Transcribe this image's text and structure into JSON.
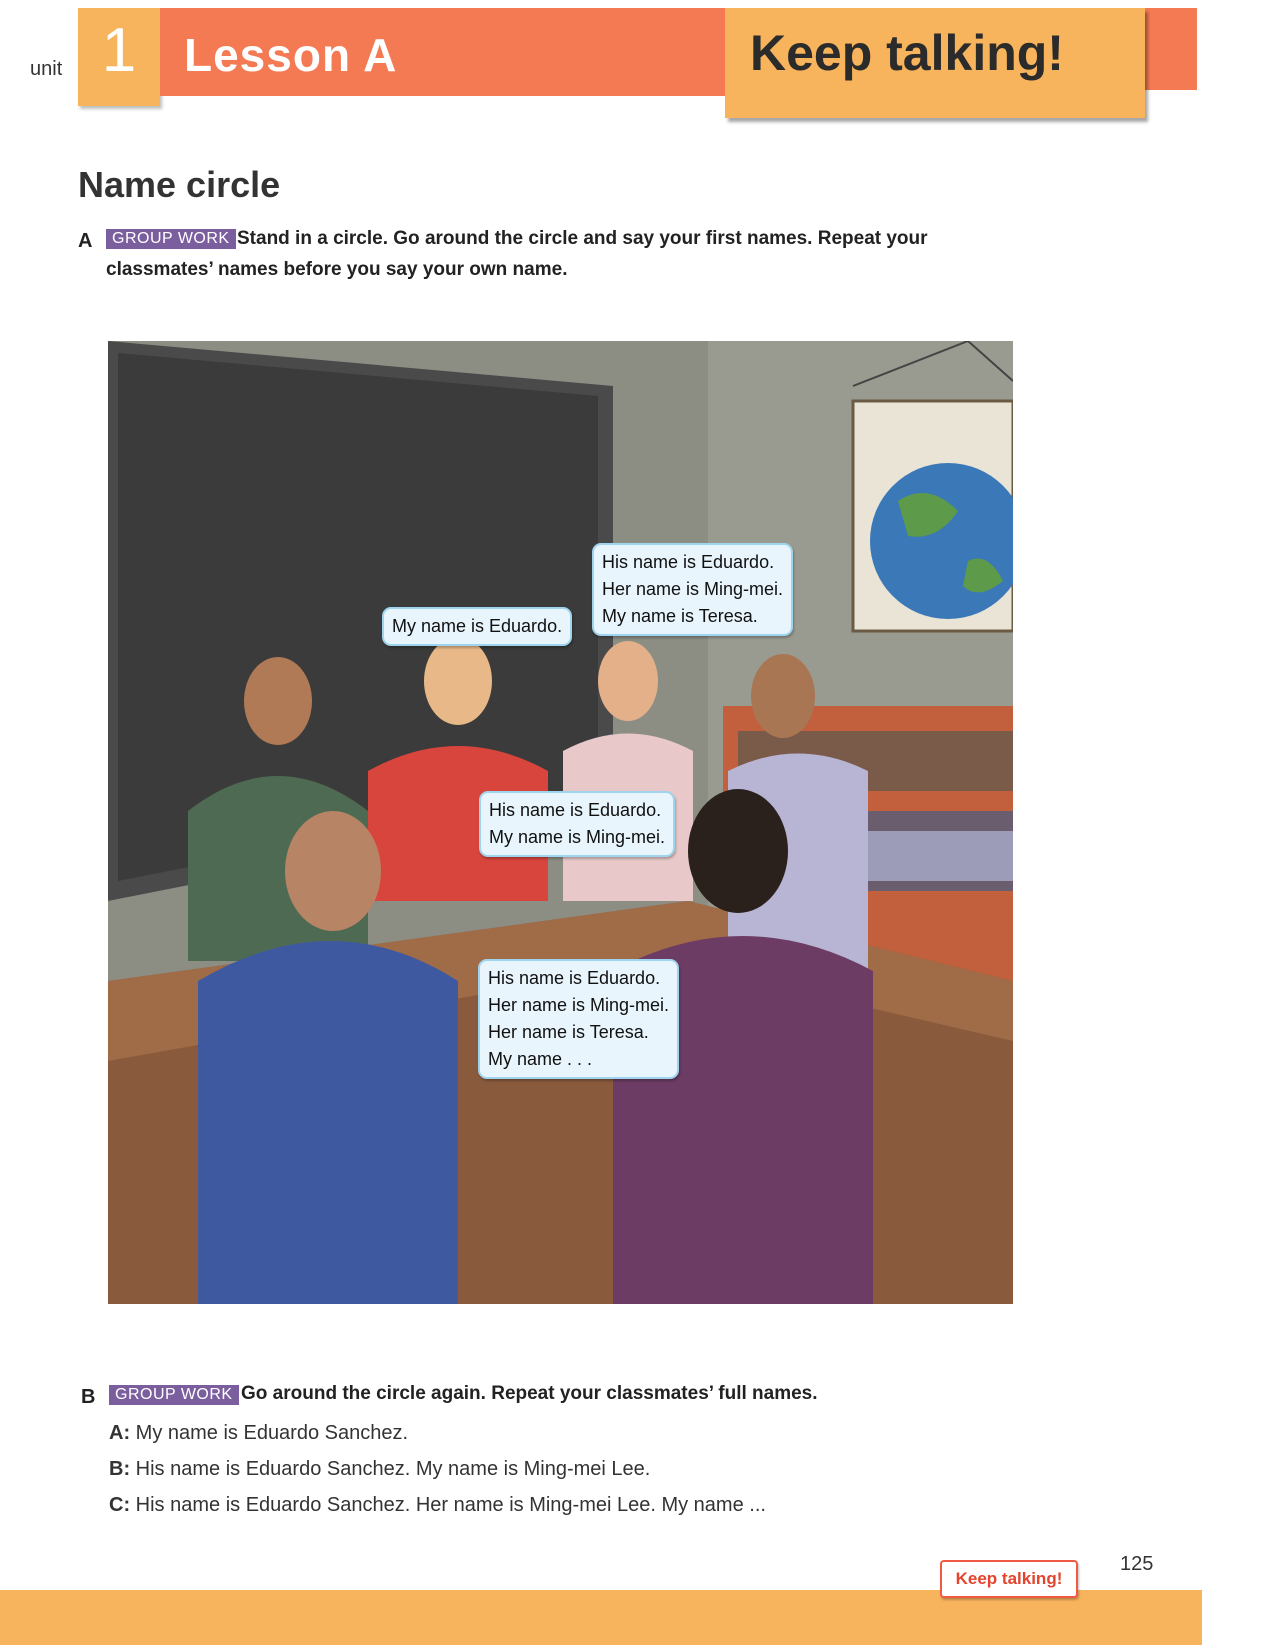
{
  "header": {
    "unit_label": "unit",
    "unit_number": "1",
    "lesson_title": "Lesson A",
    "section_tab": "Keep talking!"
  },
  "section": {
    "title": "Name circle"
  },
  "exercise_a": {
    "letter": "A",
    "tag": "GROUP WORK",
    "line1": "Stand in a circle. Go around the circle and say your first names. Repeat your",
    "line2": "classmates’ names before you say your own name."
  },
  "illustration": {
    "bubbles": [
      {
        "lines": [
          "My name is Eduardo."
        ]
      },
      {
        "lines": [
          "His name is Eduardo.",
          "Her name is Ming-mei.",
          "My name is Teresa."
        ]
      },
      {
        "lines": [
          "His name is Eduardo.",
          "My name is Ming-mei."
        ]
      },
      {
        "lines": [
          "His name is Eduardo.",
          "Her name is Ming-mei.",
          "Her name is Teresa.",
          "My name . . ."
        ]
      }
    ]
  },
  "exercise_b": {
    "letter": "B",
    "tag": "GROUP WORK",
    "instruction": "Go around the circle again. Repeat your classmates’ full names.",
    "dialog": [
      {
        "speaker": "A:",
        "text": "My name is Eduardo Sanchez."
      },
      {
        "speaker": "B:",
        "text": "His name is Eduardo Sanchez. My name is Ming-mei Lee."
      },
      {
        "speaker": "C:",
        "text": "His name is Eduardo Sanchez. Her name is Ming-mei Lee. My name ..."
      }
    ]
  },
  "footer": {
    "tag": "Keep talking!",
    "page_number": "125"
  },
  "colors": {
    "header_orange": "#f47a54",
    "tab_yellow": "#f8b45c",
    "tag_purple": "#7b5e9e",
    "bubble_blue": "#e8f5fc"
  }
}
